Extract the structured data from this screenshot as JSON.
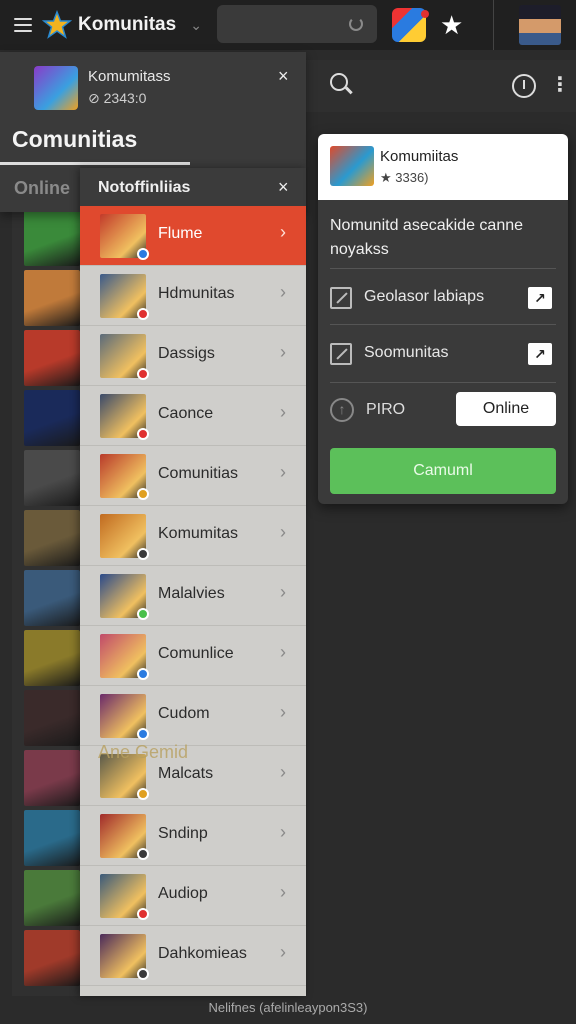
{
  "topbar": {
    "title": "Komunitas",
    "chevron": "⌄",
    "icons": [
      "hamburger-menu-icon",
      "star-logo-icon",
      "refresh-icon",
      "game-badge-icon",
      "star-icon",
      "avatar"
    ]
  },
  "comm_panel": {
    "item_name": "Komumitass",
    "item_sub": "⊘ 2343:0",
    "close": "×",
    "header": "Comunitias",
    "tab": "Online"
  },
  "notifications": {
    "title": "Notoffinliias",
    "close": "×",
    "overlay_text": "Ane Gemid",
    "items": [
      {
        "label": "Flume",
        "color": "#c23a2a",
        "dot": "#2a7be0",
        "active": true
      },
      {
        "label": "Hdmunitas",
        "color": "#3a5a8a",
        "dot": "#e03030",
        "active": false
      },
      {
        "label": "Dassigs",
        "color": "#5a6a7a",
        "dot": "#e03030",
        "active": false
      },
      {
        "label": "Caonce",
        "color": "#3a4a6a",
        "dot": "#e03030",
        "active": false
      },
      {
        "label": "Comunitias",
        "color": "#b83a2a",
        "dot": "#e0a020",
        "active": false
      },
      {
        "label": "Komumitas",
        "color": "#c06a20",
        "dot": "#3a3a3a",
        "active": false
      },
      {
        "label": "Malalvies",
        "color": "#2a4a8a",
        "dot": "#4ac04a",
        "active": false
      },
      {
        "label": "Comunlice",
        "color": "#c04a6a",
        "dot": "#2a7be0",
        "active": false
      },
      {
        "label": "Cudom",
        "color": "#6a2a6a",
        "dot": "#2a7be0",
        "active": false
      },
      {
        "label": "Malcats",
        "color": "#5a5a4a",
        "dot": "#e0a020",
        "active": false
      },
      {
        "label": "Sndinp",
        "color": "#a02a2a",
        "dot": "#3a3a3a",
        "active": false
      },
      {
        "label": "Audiop",
        "color": "#3a5a7a",
        "dot": "#e03030",
        "active": false
      },
      {
        "label": "Dahkomieas",
        "color": "#4a2a5a",
        "dot": "#3a3a3a",
        "active": false
      }
    ]
  },
  "thumbnails": [
    "#3a8a3a",
    "#c07a3a",
    "#b83a2a",
    "#1a2a5a",
    "#4a4a4a",
    "#6a5a3a",
    "#3a5a7a",
    "#8a7a2a",
    "#3a2a2a",
    "#7a3a4a",
    "#2a6a8a",
    "#4a7a3a",
    "#a03a2a"
  ],
  "card": {
    "item_name": "Komumiitas",
    "item_sub": "★ 3336)",
    "description": "Nomunitd asecakide canne noyakss",
    "options": [
      {
        "label": "Geolasor labiaps",
        "badge": "↗"
      },
      {
        "label": "Soomunitas",
        "badge": "↗"
      }
    ],
    "piro_label": "PIRO",
    "piro_icon": "↑",
    "online_button": "Online",
    "cta_button": "Camuml"
  },
  "footer": "Nelifnes (afelinleaypon3S3)"
}
